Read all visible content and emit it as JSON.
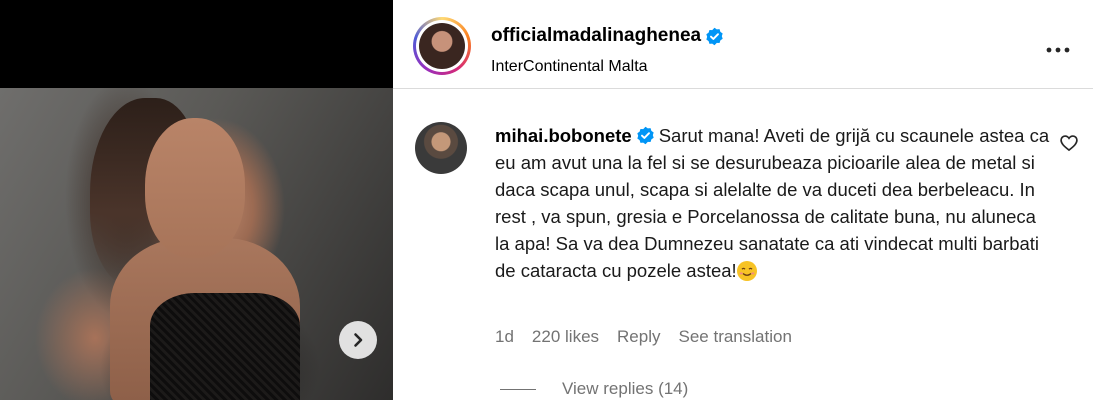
{
  "post": {
    "username": "officialmadalinaghenea",
    "location": "InterContinental Malta",
    "verified": true
  },
  "comment": {
    "username": "mihai.bobonete",
    "verified": true,
    "text": "Sarut mana! Aveti de grijă cu scaunele astea ca eu am avut una la fel si se desurubeaza picioarile alea de metal si daca scapa unul, scapa si alelalte de va duceti dea berbeleacu. In rest , va spun, gresia e Porcelanossa de calitate buna, nu aluneca la apa! Sa va dea Dumnezeu sanatate ca ati vindecat multi barbati de cataracta cu pozele astea!",
    "age": "1d",
    "likes": "220 likes",
    "reply_label": "Reply",
    "translate_label": "See translation",
    "view_replies": "View replies (14)"
  },
  "icons": {
    "next": "chevron-right-icon",
    "more": "more-horizontal-icon",
    "like": "heart-outline-icon",
    "verified": "verified-badge-icon",
    "emoji": "face-emoji-icon"
  },
  "colors": {
    "verified": "#0095f6",
    "secondary_text": "#737373",
    "divider": "#dbdbdb"
  }
}
